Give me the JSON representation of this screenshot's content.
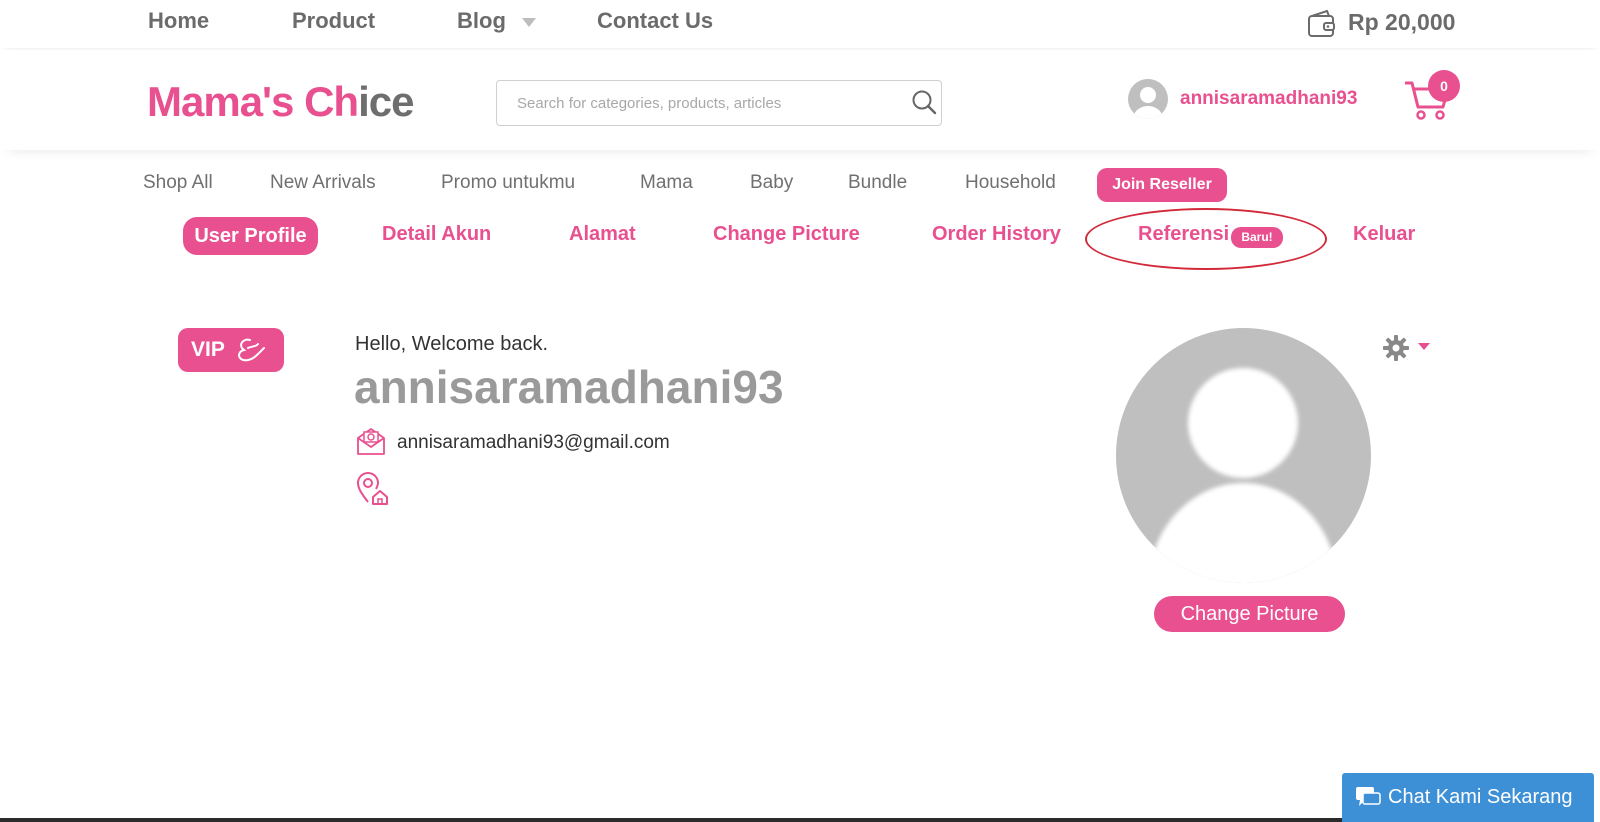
{
  "top_nav": {
    "items": [
      "Home",
      "Product",
      "Blog",
      "Contact Us"
    ],
    "balance": "Rp 20,000"
  },
  "header": {
    "logo_part1": "Mama's Ch",
    "logo_part2": "ice",
    "search_placeholder": "Search for categories, products, articles",
    "username": "annisaramadhani93",
    "cart_count": "0"
  },
  "category_nav": {
    "items": [
      "Shop All",
      "New Arrivals",
      "Promo untukmu",
      "Mama",
      "Baby",
      "Bundle",
      "Household"
    ],
    "join_label": "Join Reseller"
  },
  "profile_nav": {
    "active": "User Profile",
    "items": [
      "Detail Akun",
      "Alamat",
      "Change Picture",
      "Order History",
      "Referensi",
      "Keluar"
    ],
    "badge": "Baru!"
  },
  "profile": {
    "vip_label": "VIP",
    "welcome": "Hello, Welcome back.",
    "name": "annisaramadhani93",
    "email": "annisaramadhani93@gmail.com",
    "change_picture_label": "Change Picture"
  },
  "chat": {
    "label": "Chat Kami Sekarang"
  },
  "colors": {
    "brand_pink": "#e8508f",
    "chat_blue": "#3d8fd6",
    "highlight_red": "#d22a3a"
  },
  "icons": [
    "wallet-icon",
    "search-icon",
    "cart-icon",
    "user-avatar",
    "gear-icon",
    "email-icon",
    "address-icon",
    "chat-icon"
  ]
}
